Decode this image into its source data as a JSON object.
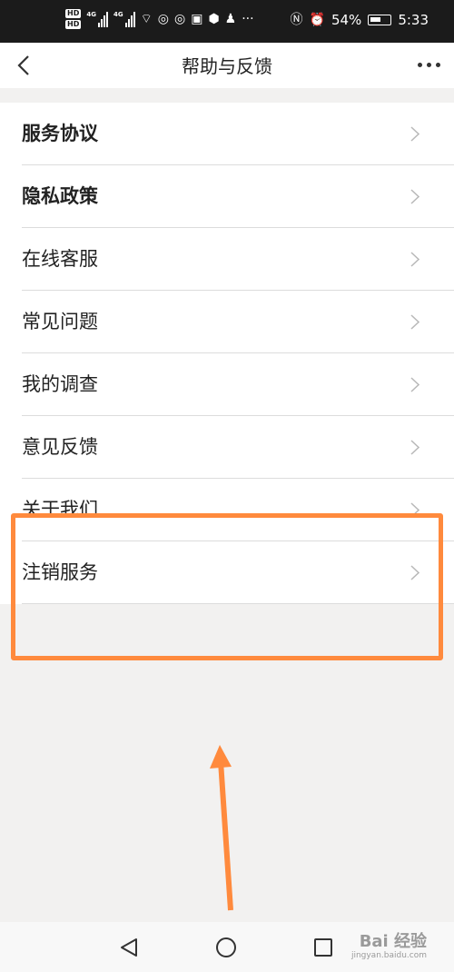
{
  "status_bar": {
    "hd1": "HD",
    "hd2": "HD",
    "net1": "4G",
    "net2": "4G",
    "battery": "54%",
    "time": "5:33"
  },
  "header": {
    "title": "帮助与反馈"
  },
  "menu": {
    "items": [
      {
        "label": "服务协议",
        "bold": true
      },
      {
        "label": "隐私政策",
        "bold": true
      },
      {
        "label": "在线客服",
        "bold": false
      },
      {
        "label": "常见问题",
        "bold": false
      },
      {
        "label": "我的调查",
        "bold": false
      },
      {
        "label": "意见反馈",
        "bold": false
      },
      {
        "label": "关于我们",
        "bold": false
      },
      {
        "label": "注销服务",
        "bold": false
      }
    ]
  },
  "overlay": {
    "color": "#ff8a3d"
  },
  "watermark": {
    "line1": "Bai 经验",
    "line2": "jingyan.baidu.com"
  }
}
